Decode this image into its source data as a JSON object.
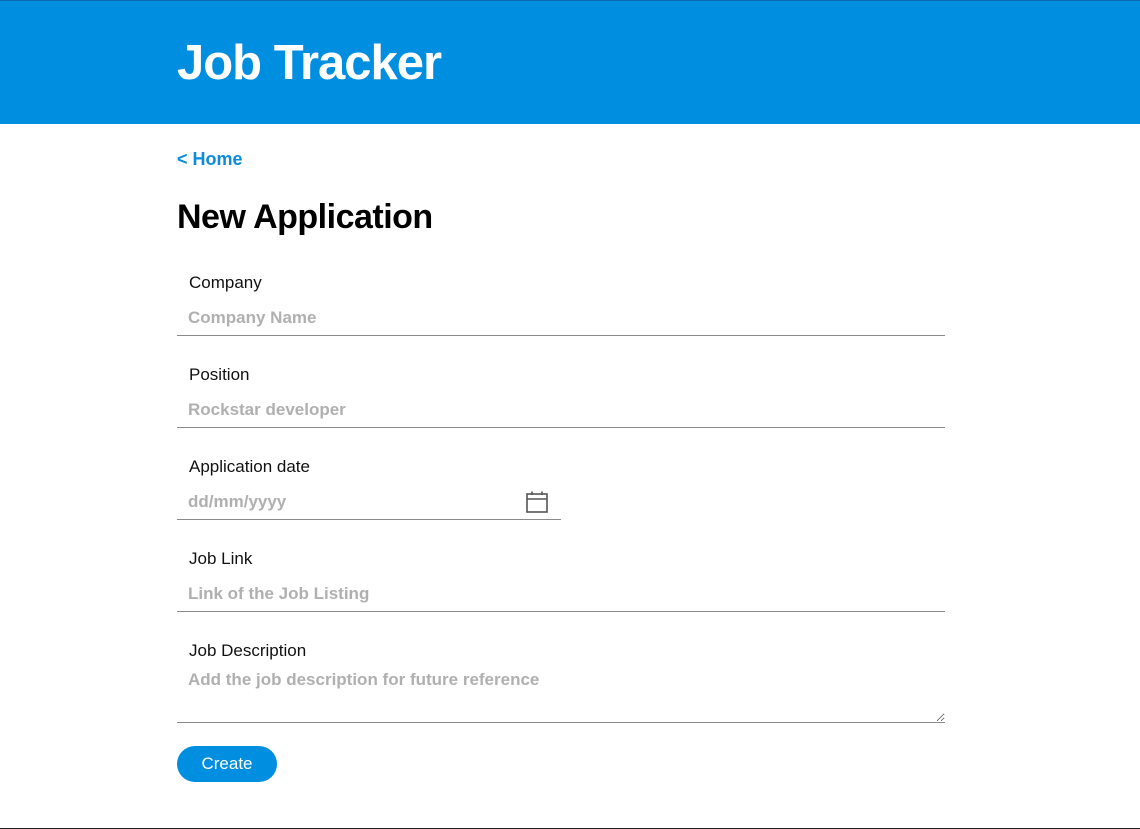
{
  "header": {
    "app_title": "Job Tracker"
  },
  "nav": {
    "home_link": "< Home"
  },
  "page_title": "New Application",
  "form": {
    "company": {
      "label": "Company",
      "placeholder": "Company Name",
      "value": ""
    },
    "position": {
      "label": "Position",
      "placeholder": "Rockstar developer",
      "value": ""
    },
    "application_date": {
      "label": "Application date",
      "placeholder": "dd/mm/yyyy",
      "icon": "calendar-icon"
    },
    "job_link": {
      "label": "Job Link",
      "placeholder": "Link of the Job Listing",
      "value": ""
    },
    "job_description": {
      "label": "Job Description",
      "placeholder": "Add the job description for future reference",
      "value": ""
    },
    "submit_label": "Create"
  },
  "colors": {
    "brand": "#008ee0",
    "link": "#0a8bdc",
    "placeholder": "#b0b0b0"
  }
}
